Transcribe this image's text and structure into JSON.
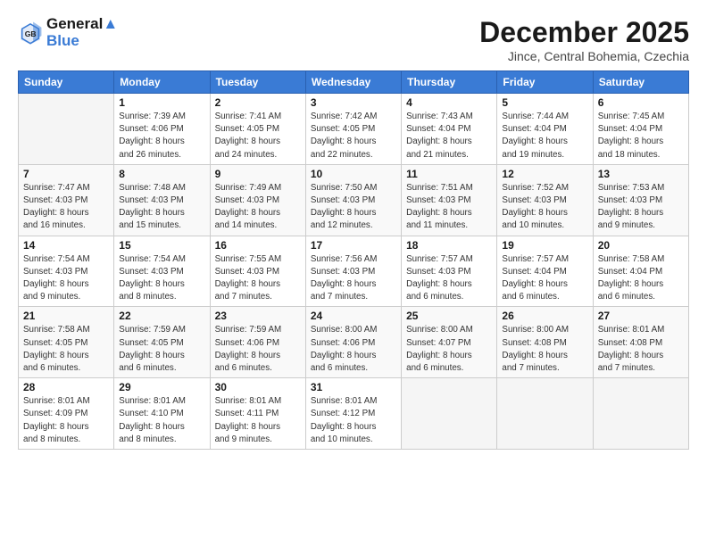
{
  "logo": {
    "line1": "General",
    "line2": "Blue"
  },
  "title": "December 2025",
  "subtitle": "Jince, Central Bohemia, Czechia",
  "weekdays": [
    "Sunday",
    "Monday",
    "Tuesday",
    "Wednesday",
    "Thursday",
    "Friday",
    "Saturday"
  ],
  "weeks": [
    [
      {
        "day": "",
        "info": ""
      },
      {
        "day": "1",
        "info": "Sunrise: 7:39 AM\nSunset: 4:06 PM\nDaylight: 8 hours\nand 26 minutes."
      },
      {
        "day": "2",
        "info": "Sunrise: 7:41 AM\nSunset: 4:05 PM\nDaylight: 8 hours\nand 24 minutes."
      },
      {
        "day": "3",
        "info": "Sunrise: 7:42 AM\nSunset: 4:05 PM\nDaylight: 8 hours\nand 22 minutes."
      },
      {
        "day": "4",
        "info": "Sunrise: 7:43 AM\nSunset: 4:04 PM\nDaylight: 8 hours\nand 21 minutes."
      },
      {
        "day": "5",
        "info": "Sunrise: 7:44 AM\nSunset: 4:04 PM\nDaylight: 8 hours\nand 19 minutes."
      },
      {
        "day": "6",
        "info": "Sunrise: 7:45 AM\nSunset: 4:04 PM\nDaylight: 8 hours\nand 18 minutes."
      }
    ],
    [
      {
        "day": "7",
        "info": "Sunrise: 7:47 AM\nSunset: 4:03 PM\nDaylight: 8 hours\nand 16 minutes."
      },
      {
        "day": "8",
        "info": "Sunrise: 7:48 AM\nSunset: 4:03 PM\nDaylight: 8 hours\nand 15 minutes."
      },
      {
        "day": "9",
        "info": "Sunrise: 7:49 AM\nSunset: 4:03 PM\nDaylight: 8 hours\nand 14 minutes."
      },
      {
        "day": "10",
        "info": "Sunrise: 7:50 AM\nSunset: 4:03 PM\nDaylight: 8 hours\nand 12 minutes."
      },
      {
        "day": "11",
        "info": "Sunrise: 7:51 AM\nSunset: 4:03 PM\nDaylight: 8 hours\nand 11 minutes."
      },
      {
        "day": "12",
        "info": "Sunrise: 7:52 AM\nSunset: 4:03 PM\nDaylight: 8 hours\nand 10 minutes."
      },
      {
        "day": "13",
        "info": "Sunrise: 7:53 AM\nSunset: 4:03 PM\nDaylight: 8 hours\nand 9 minutes."
      }
    ],
    [
      {
        "day": "14",
        "info": "Sunrise: 7:54 AM\nSunset: 4:03 PM\nDaylight: 8 hours\nand 9 minutes."
      },
      {
        "day": "15",
        "info": "Sunrise: 7:54 AM\nSunset: 4:03 PM\nDaylight: 8 hours\nand 8 minutes."
      },
      {
        "day": "16",
        "info": "Sunrise: 7:55 AM\nSunset: 4:03 PM\nDaylight: 8 hours\nand 7 minutes."
      },
      {
        "day": "17",
        "info": "Sunrise: 7:56 AM\nSunset: 4:03 PM\nDaylight: 8 hours\nand 7 minutes."
      },
      {
        "day": "18",
        "info": "Sunrise: 7:57 AM\nSunset: 4:03 PM\nDaylight: 8 hours\nand 6 minutes."
      },
      {
        "day": "19",
        "info": "Sunrise: 7:57 AM\nSunset: 4:04 PM\nDaylight: 8 hours\nand 6 minutes."
      },
      {
        "day": "20",
        "info": "Sunrise: 7:58 AM\nSunset: 4:04 PM\nDaylight: 8 hours\nand 6 minutes."
      }
    ],
    [
      {
        "day": "21",
        "info": "Sunrise: 7:58 AM\nSunset: 4:05 PM\nDaylight: 8 hours\nand 6 minutes."
      },
      {
        "day": "22",
        "info": "Sunrise: 7:59 AM\nSunset: 4:05 PM\nDaylight: 8 hours\nand 6 minutes."
      },
      {
        "day": "23",
        "info": "Sunrise: 7:59 AM\nSunset: 4:06 PM\nDaylight: 8 hours\nand 6 minutes."
      },
      {
        "day": "24",
        "info": "Sunrise: 8:00 AM\nSunset: 4:06 PM\nDaylight: 8 hours\nand 6 minutes."
      },
      {
        "day": "25",
        "info": "Sunrise: 8:00 AM\nSunset: 4:07 PM\nDaylight: 8 hours\nand 6 minutes."
      },
      {
        "day": "26",
        "info": "Sunrise: 8:00 AM\nSunset: 4:08 PM\nDaylight: 8 hours\nand 7 minutes."
      },
      {
        "day": "27",
        "info": "Sunrise: 8:01 AM\nSunset: 4:08 PM\nDaylight: 8 hours\nand 7 minutes."
      }
    ],
    [
      {
        "day": "28",
        "info": "Sunrise: 8:01 AM\nSunset: 4:09 PM\nDaylight: 8 hours\nand 8 minutes."
      },
      {
        "day": "29",
        "info": "Sunrise: 8:01 AM\nSunset: 4:10 PM\nDaylight: 8 hours\nand 8 minutes."
      },
      {
        "day": "30",
        "info": "Sunrise: 8:01 AM\nSunset: 4:11 PM\nDaylight: 8 hours\nand 9 minutes."
      },
      {
        "day": "31",
        "info": "Sunrise: 8:01 AM\nSunset: 4:12 PM\nDaylight: 8 hours\nand 10 minutes."
      },
      {
        "day": "",
        "info": ""
      },
      {
        "day": "",
        "info": ""
      },
      {
        "day": "",
        "info": ""
      }
    ]
  ]
}
